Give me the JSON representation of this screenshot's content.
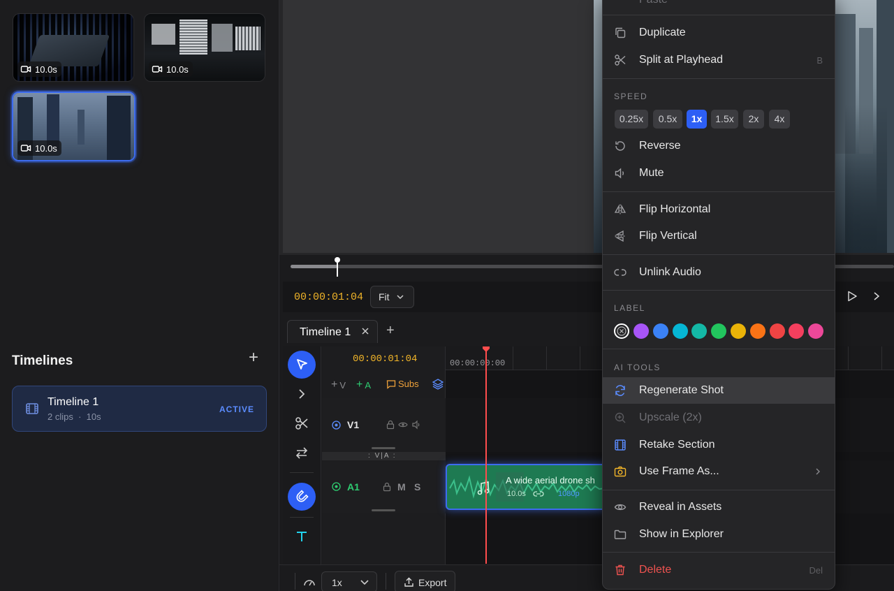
{
  "assets": {
    "clips": [
      {
        "duration": "10.0s"
      },
      {
        "duration": "10.0s"
      },
      {
        "duration": "10.0s"
      }
    ]
  },
  "timelines_panel": {
    "heading": "Timelines",
    "items": [
      {
        "name": "Timeline 1",
        "clips": "2 clips",
        "duration": "10s",
        "status": "ACTIVE"
      }
    ]
  },
  "transport": {
    "timecode": "00:00:01:04",
    "fit_label": "Fit"
  },
  "tabs": [
    {
      "label": "Timeline 1"
    }
  ],
  "ruler": {
    "timecode": "00:00:01:04",
    "start_label": "00:00:00:00"
  },
  "track_add": {
    "video": "V",
    "audio": "A",
    "subs": "Subs"
  },
  "tracks": {
    "v1": {
      "name": "V1"
    },
    "divider": "V|A",
    "a1": {
      "name": "A1",
      "mute": "M",
      "solo": "S"
    }
  },
  "audio_clip": {
    "title": "A wide aerial drone sh",
    "duration": "10.0s",
    "resolution": "1080p"
  },
  "bottom": {
    "speed": "1x",
    "export_label": "Export"
  },
  "context_menu": {
    "paste_label": "Paste",
    "duplicate": "Duplicate",
    "split": "Split at Playhead",
    "split_shortcut": "B",
    "speed_section": "SPEED",
    "speeds": [
      "0.25x",
      "0.5x",
      "1x",
      "1.5x",
      "2x",
      "4x"
    ],
    "selected_speed": "1x",
    "reverse": "Reverse",
    "mute": "Mute",
    "flip_h": "Flip Horizontal",
    "flip_v": "Flip Vertical",
    "unlink": "Unlink Audio",
    "label_section": "LABEL",
    "label_colors": [
      "#a855f7",
      "#3b82f6",
      "#06b6d4",
      "#14b8a6",
      "#22c55e",
      "#eab308",
      "#f97316",
      "#ef4444",
      "#f43f5e",
      "#ec4899"
    ],
    "ai_section": "AI TOOLS",
    "regenerate": "Regenerate Shot",
    "upscale": "Upscale (2x)",
    "retake": "Retake Section",
    "use_frame": "Use Frame As...",
    "reveal": "Reveal in Assets",
    "show_explorer": "Show in Explorer",
    "delete": "Delete",
    "delete_shortcut": "Del"
  },
  "colors": {
    "accent": "#2d5ff5",
    "timecode": "#f0b429",
    "playhead": "#ff4d4d",
    "audio_clip": "#1e7a52",
    "danger": "#ef5350"
  }
}
